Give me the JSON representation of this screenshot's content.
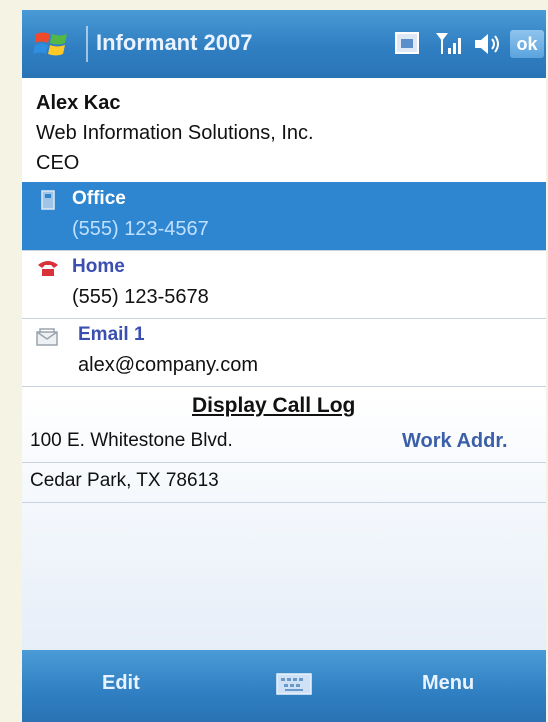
{
  "titlebar": {
    "app_title": "Informant 2007",
    "ok_label": "ok",
    "icons": [
      "windows-start-icon",
      "calendar-icon",
      "signal-icon",
      "volume-icon"
    ]
  },
  "contact": {
    "name": "Alex Kac",
    "company": "Web Information Solutions, Inc.",
    "job_title": "CEO"
  },
  "fields": [
    {
      "label": "Office",
      "value": "(555) 123-4567",
      "icon": "office-phone-icon",
      "selected": true
    },
    {
      "label": "Home",
      "value": "(555) 123-5678",
      "icon": "home-phone-icon",
      "selected": false
    },
    {
      "label": "Email 1",
      "value": "alex@company.com",
      "icon": "email-icon",
      "selected": false
    }
  ],
  "call_log_link": "Display Call Log",
  "address": {
    "line1": "100 E. Whitestone Blvd.",
    "line2": "Cedar Park, TX  78613",
    "label": "Work Addr."
  },
  "softkeys": {
    "left": "Edit",
    "right": "Menu",
    "center_icon": "keyboard-icon"
  },
  "colors": {
    "bar_blue": "#2f7fc2",
    "selection_blue": "#2e86d0",
    "label_blue": "#3b4fb0"
  }
}
